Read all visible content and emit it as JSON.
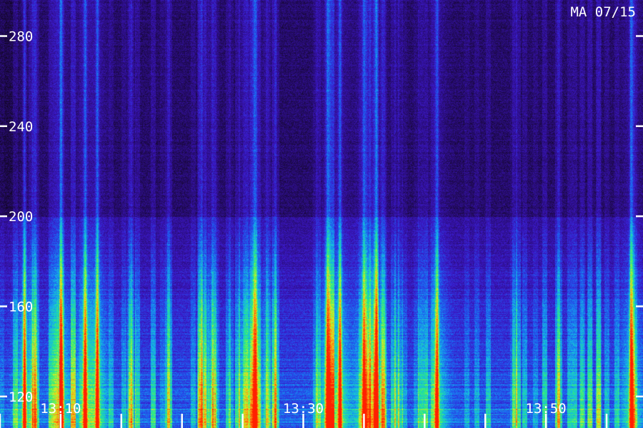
{
  "chart_data": {
    "type": "heatmap",
    "title": "",
    "station_date": "MA 07/15",
    "xlabel": "",
    "ylabel": "",
    "x_range": [
      "13:05",
      "13:58"
    ],
    "y_range": [
      106,
      296
    ],
    "y_ticks": [
      280,
      240,
      200,
      160,
      120
    ],
    "x_ticks": [
      "13:10",
      "13:30",
      "13:50"
    ],
    "minor_x_ticks": [
      "13:05",
      "13:10",
      "13:15",
      "13:20",
      "13:25",
      "13:30",
      "13:35",
      "13:40",
      "13:45",
      "13:50",
      "13:55"
    ],
    "background_band_boundary_y": 200,
    "bright_vertical_events": [
      "13:07",
      "13:10",
      "13:12",
      "13:13",
      "13:26",
      "13:32",
      "13:33",
      "13:35",
      "13:36",
      "13:41",
      "13:57"
    ],
    "colormap": [
      "#120626",
      "#2a0d7a",
      "#3b18c8",
      "#1e5cf0",
      "#14b8e8",
      "#2ef07a",
      "#d8f020",
      "#ff8010",
      "#ff2000"
    ],
    "grid": false,
    "legend": "none"
  }
}
